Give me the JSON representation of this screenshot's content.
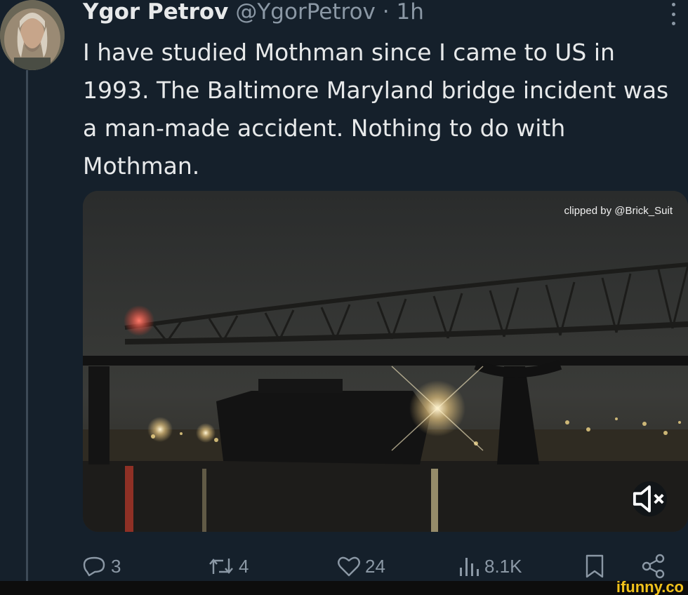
{
  "tweet": {
    "display_name": "Ygor Petrov",
    "handle": "@YgorPetrov",
    "separator": "·",
    "time": "1h",
    "text": "I have studied Mothman since I came to US in 1993. The Baltimore Maryland bridge incident was a man-made accident. Nothing to do with Mothman.",
    "avatar_icon": "user-avatar",
    "more_icon": "more-vertical-icon"
  },
  "media": {
    "type": "video",
    "overlay_credit": "clipped by @Brick_Suit",
    "mute_icon": "muted-speaker-icon"
  },
  "actions": {
    "reply": {
      "icon": "reply-icon",
      "count": "3"
    },
    "repost": {
      "icon": "repost-icon",
      "count": "4"
    },
    "like": {
      "icon": "heart-icon",
      "count": "24"
    },
    "views": {
      "icon": "views-chart-icon",
      "count": "8.1K"
    },
    "bookmark": {
      "icon": "bookmark-icon"
    },
    "share": {
      "icon": "share-icon"
    }
  },
  "watermark": "ifunny.co",
  "colors": {
    "background": "#15202b",
    "primary_text": "#e7e9ea",
    "secondary_text": "#8b98a5",
    "watermark": "#f2c21b"
  }
}
